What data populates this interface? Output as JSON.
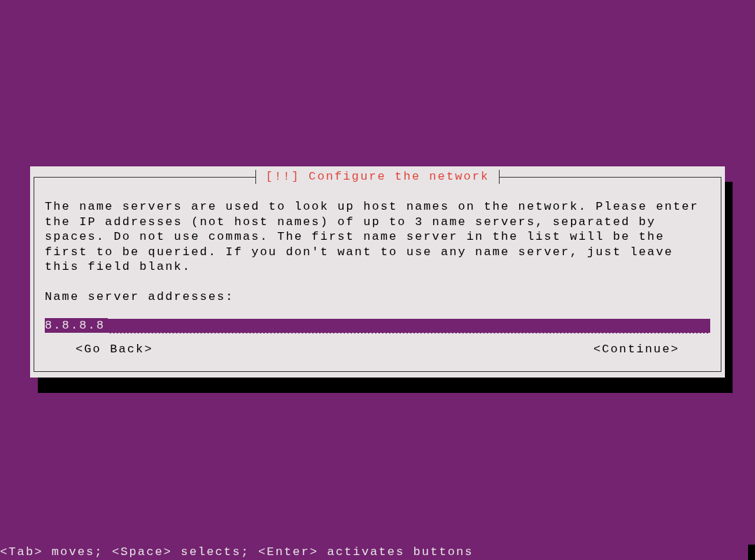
{
  "dialog": {
    "title": "[!!] Configure the network",
    "description": "The name servers are used to look up host names on the network. Please enter the IP addresses (not host names) of up to 3 name servers, separated by spaces. Do not use commas. The first name server in the list will be the first to be queried. If you don't want to use any name server, just leave this field blank.",
    "field": {
      "label": "Name server addresses:",
      "value": "8.8.8.8"
    },
    "buttons": [
      {
        "label": "<Go Back>",
        "selected": false
      },
      {
        "label": "<Continue>",
        "selected": false
      }
    ]
  },
  "status_bar": "<Tab> moves; <Space> selects; <Enter> activates buttons"
}
